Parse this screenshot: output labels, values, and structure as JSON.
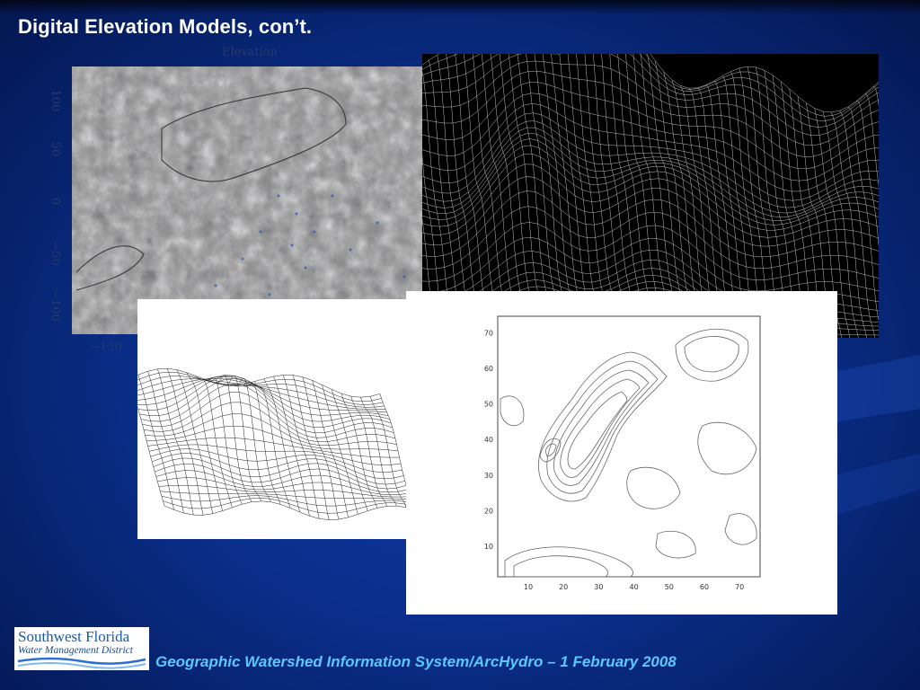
{
  "slide": {
    "title": "Digital Elevation Models, con’t.",
    "footer": "Geographic Watershed Information System/ArcHydro – 1 February 2008"
  },
  "logo": {
    "line1": "Southwest Florida",
    "line2": "Water Management District"
  },
  "shaded_relief": {
    "title": "Elevation",
    "y_ticks": [
      "100",
      "50",
      "0",
      "−50",
      "−100"
    ],
    "x_ticks": [
      "−150"
    ]
  },
  "contour_plot": {
    "x_ticks": [
      "10",
      "20",
      "30",
      "40",
      "50",
      "60",
      "70"
    ],
    "y_ticks": [
      "10",
      "20",
      "30",
      "40",
      "50",
      "60",
      "70"
    ]
  },
  "colors": {
    "background": "#0a2f8c",
    "title_text": "#ffffff",
    "footer_text": "#5bc8ff"
  }
}
